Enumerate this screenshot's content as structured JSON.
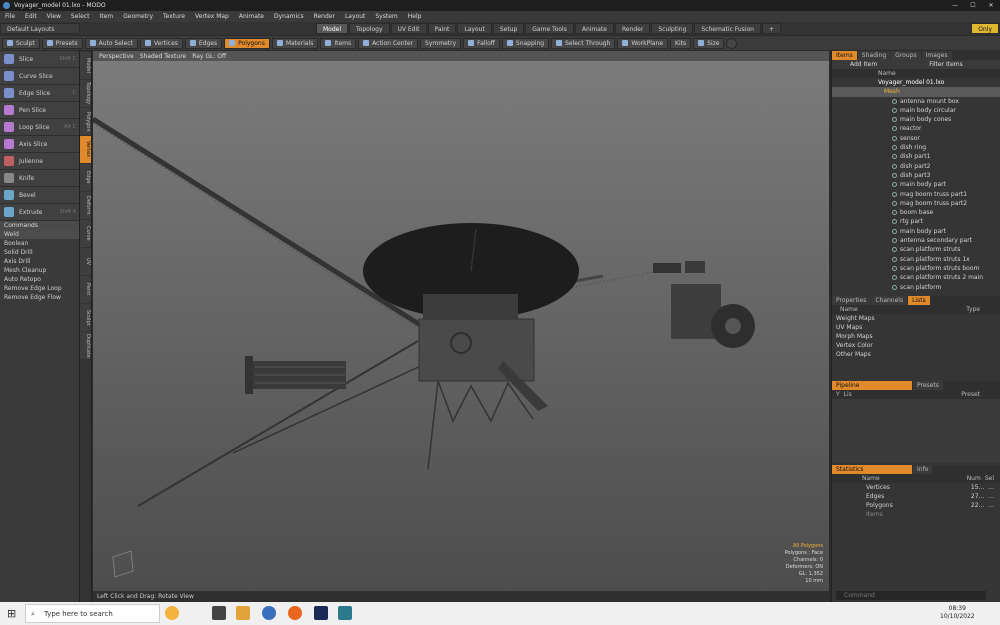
{
  "window": {
    "title": "Voyager_model 01.lxo - MODO",
    "min": "—",
    "max": "☐",
    "close": "✕"
  },
  "menu": [
    "File",
    "Edit",
    "View",
    "Select",
    "Item",
    "Geometry",
    "Texture",
    "Vertex Map",
    "Animate",
    "Dynamics",
    "Render",
    "Layout",
    "System",
    "Help"
  ],
  "layout": {
    "left": "Default Layouts",
    "tabs": [
      "Model",
      "Topology",
      "UV Edit",
      "Paint",
      "Layout",
      "Setup",
      "Game Tools",
      "Animate",
      "Render",
      "Sculpting",
      "Schematic Fusion"
    ],
    "active_tab": "Model",
    "right": "Only",
    "add": "+"
  },
  "toolbar": {
    "items": [
      "Sculpt",
      "Presets",
      "Auto Select",
      "Vertices",
      "Edges",
      "Polygons",
      "Materials",
      "Items",
      "Action Center",
      "Symmetry",
      "Falloff",
      "Snapping",
      "Select Through",
      "WorkPlane",
      "Kits",
      "Size"
    ],
    "active": "Polygons"
  },
  "tools": [
    {
      "label": "Slice",
      "shortcut": "Shift C",
      "color": "#7a8fcc"
    },
    {
      "label": "Curve Slice",
      "shortcut": "",
      "color": "#7a8fcc"
    },
    {
      "label": "Edge Slice",
      "shortcut": "C",
      "color": "#7a8fcc"
    },
    {
      "label": "Pen Slice",
      "shortcut": "",
      "color": "#b57ad0"
    },
    {
      "label": "Loop Slice",
      "shortcut": "Alt C",
      "color": "#b57ad0"
    },
    {
      "label": "Axis Slice",
      "shortcut": "",
      "color": "#b57ad0"
    },
    {
      "label": "Julienne",
      "shortcut": "",
      "color": "#c06060"
    },
    {
      "label": "Knife",
      "shortcut": "",
      "color": "#888"
    },
    {
      "label": "Bevel",
      "shortcut": "",
      "color": "#6aa6c8"
    },
    {
      "label": "Extrude",
      "shortcut": "Shift X",
      "color": "#6aa6c8"
    }
  ],
  "commands": {
    "title": "Commands",
    "dropdown": "Weld",
    "items": [
      "Boolean",
      "Solid Drill",
      "Axis Drill",
      "Mesh Cleanup",
      "Auto Retopo",
      "Remove Edge Loop",
      "Remove Edge Flow"
    ]
  },
  "vtabs": [
    "Model",
    "Topology",
    "Polygon",
    "Vertex",
    "Edge",
    "Deform",
    "Curve",
    "UV",
    "Paint",
    "Sculpt",
    "Duplicate"
  ],
  "vtab_active": "Vertex",
  "viewport": {
    "menus": [
      "Perspective",
      "Shaded Texture",
      "Ray GL: Off"
    ],
    "stats": {
      "selection": "All Polygons",
      "line1": "Polygons : Face",
      "line2": "Channels: 0",
      "line3": "Deformers: ON",
      "line4": "GL: 1,352",
      "line5": "10 mm"
    }
  },
  "hint": "Left Click and Drag: Rotate View",
  "items_panel": {
    "tabs": [
      "Items",
      "Shading",
      "Groups",
      "Images"
    ],
    "active": "Items",
    "toolbar": [
      "Add Item",
      "Filter Items"
    ],
    "header": "Name",
    "root": "Voyager_model 01.lxo",
    "mesh": "Mesh",
    "children": [
      "antenna mount box",
      "main body circular",
      "main body cones",
      "reactor",
      "sensor",
      "dish ring",
      "dish part1",
      "dish part2",
      "dish part3",
      "main body part",
      "mag boom truss part1",
      "mag boom truss part2",
      "boom base",
      "rtg part",
      "main body part",
      "antenna secondary part",
      "scan platform struts",
      "scan platform struts 1x",
      "scan platform struts boom",
      "scan platform struts 2 main",
      "scan platform"
    ]
  },
  "props_panel": {
    "tabs": [
      "Properties",
      "Channels",
      "Lists"
    ],
    "active": "Lists",
    "header": [
      "Name",
      "Type"
    ],
    "rows": [
      "Weight Maps",
      "UV Maps",
      "Morph Maps",
      "Vertex Color",
      "Other Maps"
    ]
  },
  "pipeline_panel": {
    "tabs": [
      "Pipeline",
      "Presets"
    ],
    "active": "Pipeline",
    "header": [
      "Y",
      "Lis",
      "Preset"
    ]
  },
  "stats_panel": {
    "tabs": [
      "Statistics",
      "Info"
    ],
    "active": "Statistics",
    "header": [
      "Name",
      "Num",
      "Sel"
    ],
    "rows": [
      {
        "name": "Vertices",
        "num": "15...",
        "sel": "..."
      },
      {
        "name": "Edges",
        "num": "27...",
        "sel": "..."
      },
      {
        "name": "Polygons",
        "num": "22...",
        "sel": "..."
      },
      {
        "name": "Items",
        "num": "",
        "sel": ""
      }
    ]
  },
  "command_line": {
    "placeholder": "Command"
  },
  "taskbar": {
    "search": "Type here to search",
    "time": "08:39",
    "date": "10/10/2022"
  }
}
